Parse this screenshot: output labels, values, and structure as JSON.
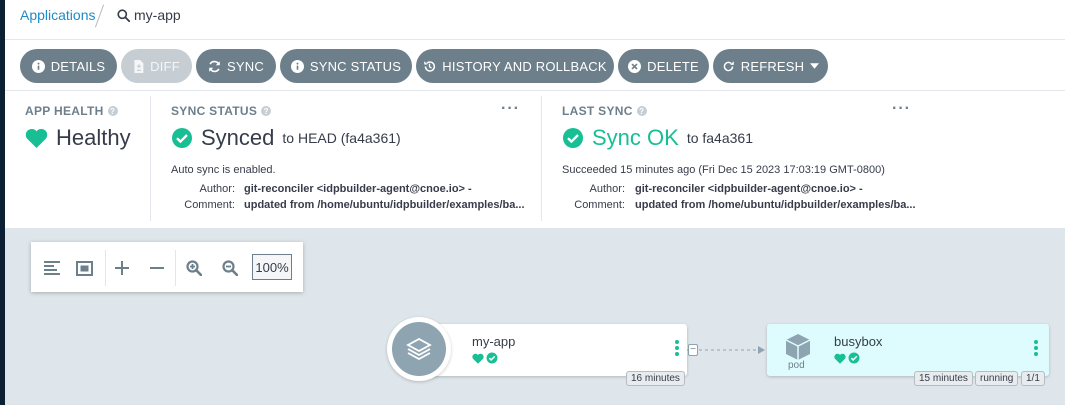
{
  "breadcrumb": {
    "parent": "Applications",
    "current": "my-app"
  },
  "toolbar": {
    "details": "DETAILS",
    "diff": "DIFF",
    "sync": "SYNC",
    "sync_status": "SYNC STATUS",
    "history": "HISTORY AND ROLLBACK",
    "delete": "DELETE",
    "refresh": "REFRESH"
  },
  "app_health": {
    "label": "APP HEALTH",
    "value": "Healthy"
  },
  "sync_status": {
    "label": "SYNC STATUS",
    "value": "Synced",
    "target": "to HEAD (fa4a361)",
    "note": "Auto sync is enabled.",
    "author_key": "Author:",
    "author": "git-reconciler <idpbuilder-agent@cnoe.io> -",
    "comment_key": "Comment:",
    "comment": "updated from /home/ubuntu/idpbuilder/examples/ba..."
  },
  "last_sync": {
    "label": "LAST SYNC",
    "value": "Sync OK",
    "target": "to fa4a361",
    "note": "Succeeded 15 minutes ago (Fri Dec 15 2023 17:03:19 GMT-0800)",
    "author_key": "Author:",
    "author": "git-reconciler <idpbuilder-agent@cnoe.io> -",
    "comment_key": "Comment:",
    "comment": "updated from /home/ubuntu/idpbuilder/examples/ba..."
  },
  "graph": {
    "zoom": "100%",
    "app_node": {
      "name": "my-app",
      "age": "16 minutes"
    },
    "pod_node": {
      "name": "busybox",
      "kind": "pod",
      "age": "15 minutes",
      "status": "running",
      "ready": "1/1"
    }
  },
  "colors": {
    "healthy": "#18be94",
    "link": "#1e8ac7",
    "button": "#6d7f8b",
    "graph_bg": "#dee6eb",
    "pod_bg": "#defcfe"
  },
  "icons": [
    "search-icon",
    "info-icon",
    "diff-icon",
    "sync-icon",
    "history-icon",
    "delete-icon",
    "refresh-icon",
    "caret-down-icon",
    "heart-icon",
    "check-circle-icon",
    "kebab-icon",
    "layers-icon",
    "cube-icon"
  ]
}
